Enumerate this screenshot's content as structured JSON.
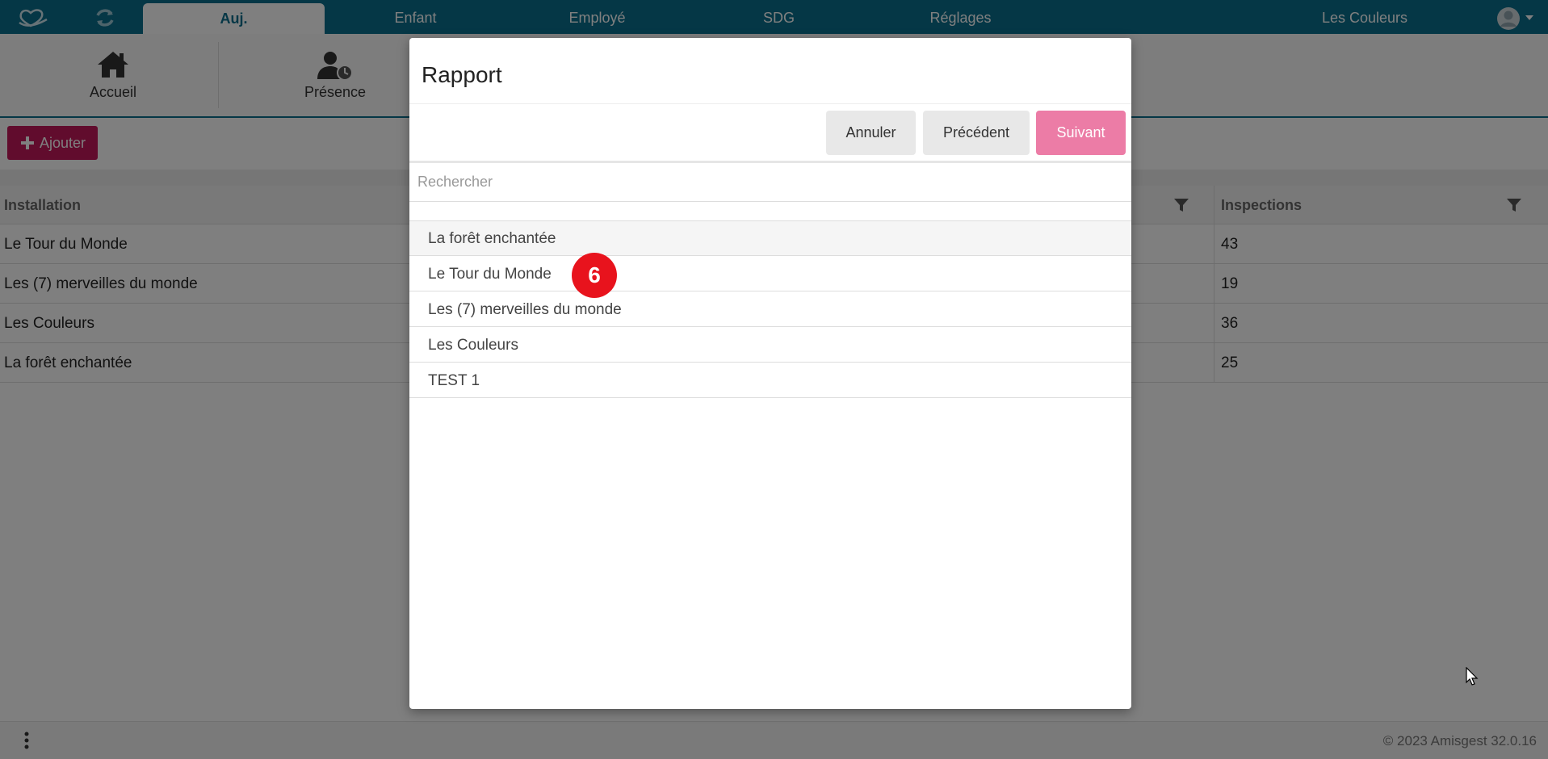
{
  "nav": {
    "tabs": [
      {
        "label": "Auj.",
        "active": true
      },
      {
        "label": "Enfant"
      },
      {
        "label": "Employé"
      },
      {
        "label": "SDG"
      },
      {
        "label": "Réglages"
      }
    ],
    "facility": "Les Couleurs",
    "icons": {
      "logo": "heart-hand-logo",
      "sync": "sync-icon",
      "user": "user-avatar-icon"
    },
    "color": "#0a6f8c"
  },
  "toolbar": {
    "items": [
      {
        "label": "Accueil",
        "icon": "home-icon"
      },
      {
        "label": "Présence",
        "icon": "user-clock-icon"
      }
    ]
  },
  "add_button": {
    "label": "Ajouter",
    "color": "#c2185b"
  },
  "table": {
    "columns": [
      "Installation",
      "Inspections"
    ],
    "rows": [
      {
        "installation": "Le Tour du Monde",
        "inspections": "43"
      },
      {
        "installation": "Les (7) merveilles du monde",
        "inspections": "19"
      },
      {
        "installation": "Les Couleurs",
        "inspections": "36"
      },
      {
        "installation": "La forêt enchantée",
        "inspections": "25"
      }
    ]
  },
  "modal": {
    "title": "Rapport",
    "buttons": {
      "cancel": "Annuler",
      "previous": "Précédent",
      "next": "Suivant"
    },
    "next_color": "#ec7ca6",
    "search_placeholder": "Rechercher",
    "items": [
      "La forêt enchantée",
      "Le Tour du Monde",
      "Les (7) merveilles du monde",
      "Les Couleurs",
      "TEST 1"
    ]
  },
  "step_badge": "6",
  "footer": {
    "copyright": "© 2023 Amisgest 32.0.16"
  }
}
